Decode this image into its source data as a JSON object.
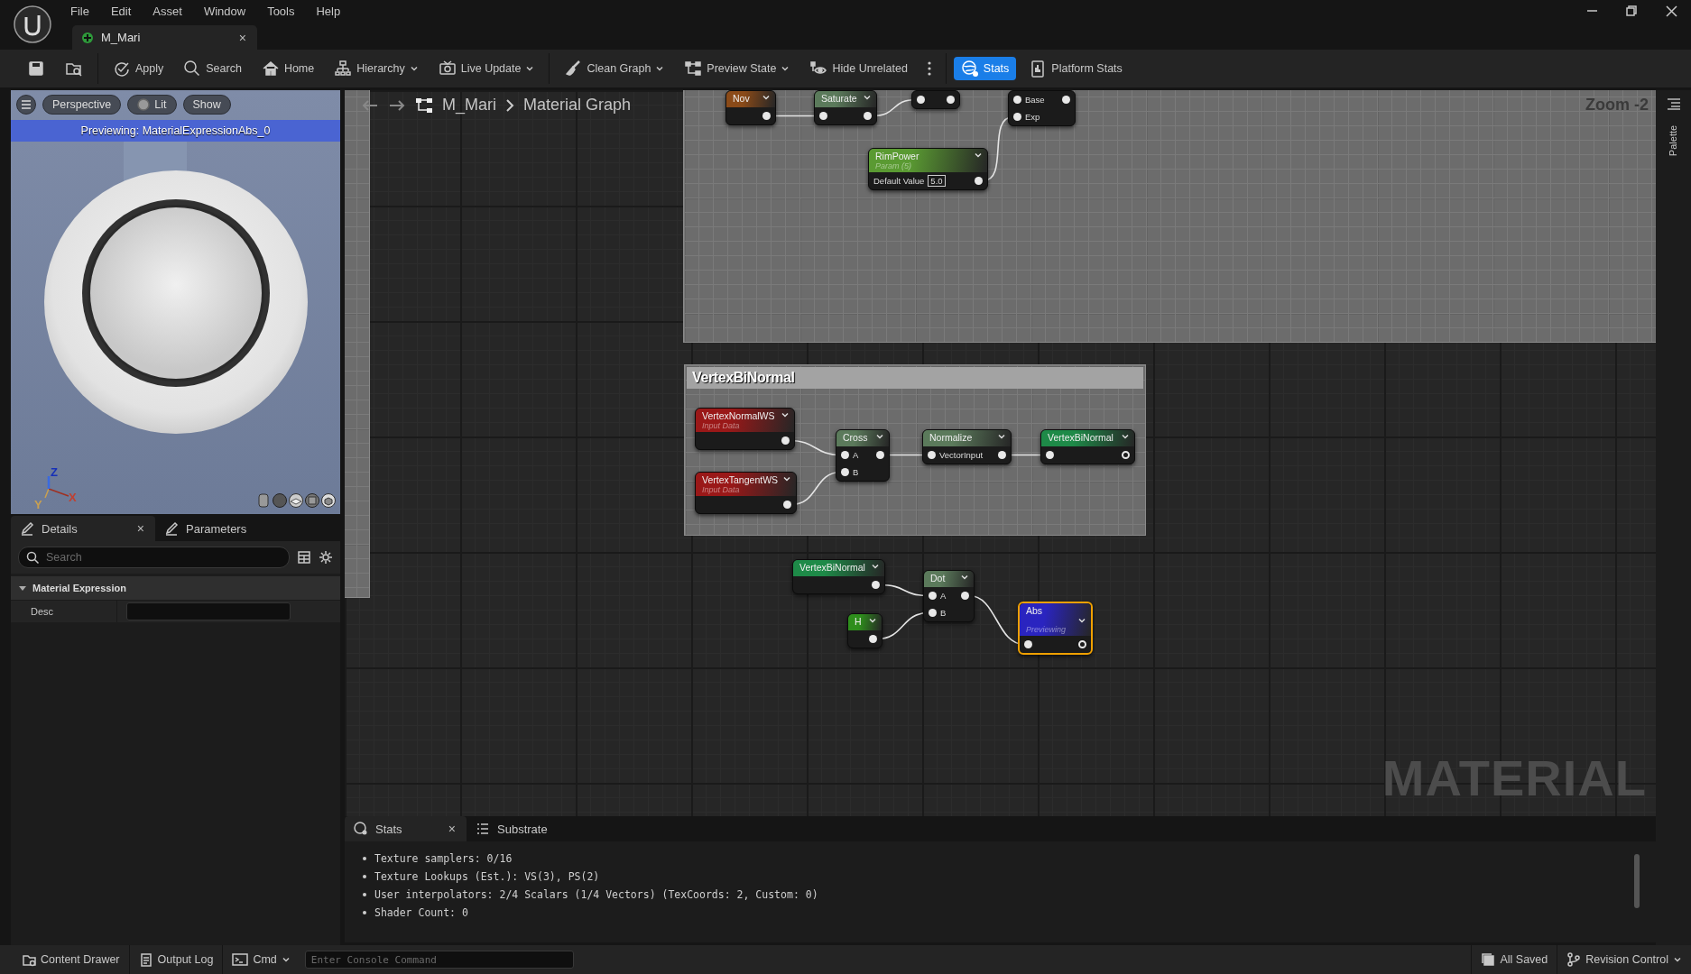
{
  "window": {
    "menu": [
      "File",
      "Edit",
      "Asset",
      "Window",
      "Tools",
      "Help"
    ],
    "tab": {
      "title": "M_Mari",
      "close": "×"
    }
  },
  "toolbar": {
    "groups": [
      [
        {
          "on": false,
          "dropdown": false
        },
        {
          "on": false,
          "dropdown": false
        }
      ],
      [
        {
          "label": "Apply",
          "on": false,
          "dropdown": false
        },
        {
          "label": "Search",
          "on": false,
          "dropdown": false
        },
        {
          "label": "Home",
          "on": false,
          "dropdown": false
        },
        {
          "label": "Hierarchy",
          "on": false,
          "dropdown": true
        },
        {
          "label": "Live Update",
          "on": false,
          "dropdown": true
        }
      ],
      [
        {
          "label": "Clean Graph",
          "on": false,
          "dropdown": true
        },
        {
          "label": "Preview State",
          "on": false,
          "dropdown": true
        },
        {
          "label": "Hide Unrelated",
          "on": false,
          "dropdown": false
        },
        {
          "on": false,
          "dropdown": false
        }
      ],
      [
        {
          "label": "Stats",
          "on": true,
          "dropdown": false
        },
        {
          "label": "Platform Stats",
          "on": false,
          "dropdown": false
        }
      ]
    ]
  },
  "viewport": {
    "buttons": [
      "Perspective",
      "Lit",
      "Show"
    ],
    "banner": "Previewing: MaterialExpressionAbs_0",
    "axes": [
      "Z",
      "X",
      "Y"
    ]
  },
  "details": {
    "tabs": [
      {
        "label": "Details",
        "selected": true,
        "close": "×"
      },
      {
        "label": "Parameters",
        "selected": false
      }
    ],
    "search": {
      "placeholder": "Search"
    },
    "section": {
      "title": "Material Expression",
      "expanded": true
    },
    "fields": [
      {
        "label": "Desc"
      }
    ]
  },
  "graph": {
    "breadcrumb": [
      "M_Mari",
      "Material Graph"
    ],
    "zoom": "Zoom -2",
    "watermark": "MATERIAL",
    "palette": "Palette",
    "comments": [
      {
        "title": "VertexBiNormal"
      }
    ],
    "nodes": [
      {
        "title": "Nov",
        "kind": "function",
        "selected": false,
        "previewing": false,
        "rows": [
          {
            "in": false,
            "out": true,
            "hollow": false
          }
        ]
      },
      {
        "title": "Saturate",
        "kind": "math",
        "selected": false,
        "previewing": false,
        "rows": [
          {
            "in": true,
            "out": true,
            "hollow": false
          }
        ]
      },
      {
        "selected": false,
        "rows": [
          {
            "in": true,
            "out": true,
            "hollow": false
          }
        ]
      },
      {
        "selected": false,
        "rows": [
          {
            "in": true,
            "label": "Base",
            "out": true,
            "hollow": false
          },
          {
            "in": true,
            "label": "Exp",
            "out": false
          }
        ]
      },
      {
        "title": "RimPower",
        "subtitle": "Param (5)",
        "kind": "parameter",
        "selected": false,
        "previewing": false,
        "rows": [
          {
            "in": false,
            "label": "Default Value",
            "value": "5.0",
            "out": true,
            "hollow": false
          }
        ]
      },
      {
        "title": "VertexNormalWS",
        "subtitle": "Input Data",
        "kind": "input",
        "selected": false,
        "previewing": false,
        "rows": [
          {
            "in": false,
            "out": true,
            "hollow": false
          }
        ]
      },
      {
        "title": "VertexTangentWS",
        "subtitle": "Input Data",
        "kind": "input",
        "selected": false,
        "previewing": false,
        "rows": [
          {
            "in": false,
            "out": true,
            "hollow": false
          }
        ]
      },
      {
        "title": "Cross",
        "kind": "math",
        "selected": false,
        "previewing": false,
        "rows": [
          {
            "in": true,
            "label": "A",
            "out": true,
            "hollow": false
          },
          {
            "in": true,
            "label": "B",
            "out": false
          }
        ]
      },
      {
        "title": "Normalize",
        "kind": "math",
        "selected": false,
        "previewing": false,
        "rows": [
          {
            "in": true,
            "label": "VectorInput",
            "out": true,
            "hollow": false
          }
        ]
      },
      {
        "title": "VertexBiNormal",
        "kind": "named",
        "selected": false,
        "previewing": false,
        "rows": [
          {
            "in": true,
            "out": true,
            "hollow": true
          }
        ]
      },
      {
        "title": "VertexBiNormal",
        "kind": "named",
        "selected": false,
        "previewing": false,
        "rows": [
          {
            "in": false,
            "out": true,
            "hollow": false
          }
        ]
      },
      {
        "title": "H",
        "kind": "constant",
        "selected": false,
        "previewing": false,
        "rows": [
          {
            "in": false,
            "out": true,
            "hollow": false
          }
        ]
      },
      {
        "title": "Dot",
        "kind": "math",
        "selected": false,
        "previewing": false,
        "rows": [
          {
            "in": true,
            "label": "A",
            "out": true,
            "hollow": false
          },
          {
            "in": true,
            "label": "B",
            "out": false
          }
        ]
      },
      {
        "title": "Abs",
        "subtitle": "Previewing",
        "selected": true,
        "previewing": true,
        "rows": [
          {
            "in": true,
            "out": true,
            "hollow": true
          }
        ]
      }
    ]
  },
  "stats": {
    "tabs": [
      {
        "label": "Stats",
        "selected": true,
        "close": "×"
      },
      {
        "label": "Substrate",
        "selected": false
      }
    ],
    "lines": [
      "Texture samplers: 0/16",
      "Texture Lookups (Est.): VS(3), PS(2)",
      "User interpolators: 2/4 Scalars (1/4 Vectors) (TexCoords: 2, Custom: 0)",
      "Shader Count: 0"
    ]
  },
  "status_bar": {
    "items": [
      "Content Drawer",
      "Output Log"
    ],
    "cmd": "Cmd",
    "console": {
      "placeholder": "Enter Console Command"
    },
    "saved": "All Saved",
    "revision": "Revision Control"
  }
}
